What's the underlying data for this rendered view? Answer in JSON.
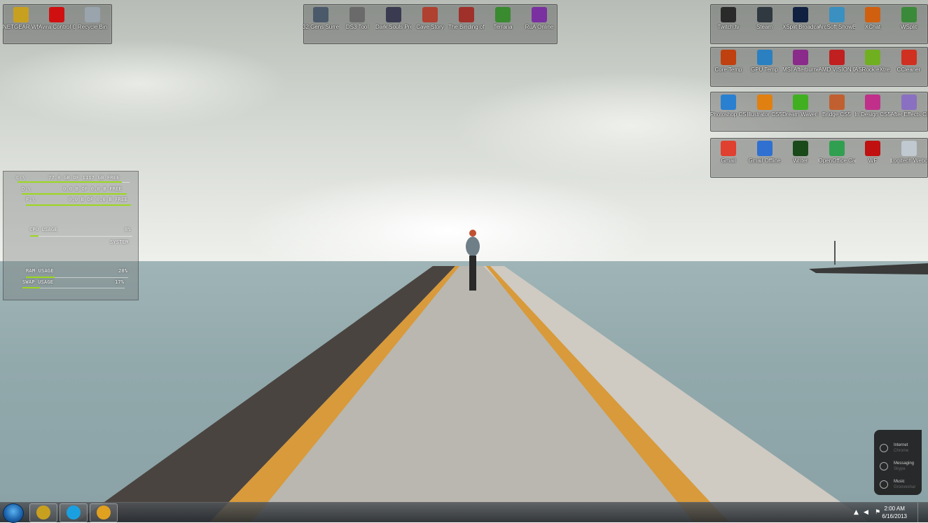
{
  "desktop_groups": {
    "top_left": [
      {
        "label": "NETGEAR WNA31...",
        "icon": "netgear-icon",
        "color": "#c8a020"
      },
      {
        "label": "Avira Control Center",
        "icon": "avira-icon",
        "color": "#d01010"
      },
      {
        "label": "Recycle Bin",
        "icon": "recycle-bin-icon",
        "color": "#9aa4ad"
      }
    ],
    "top_center": [
      {
        "label": "32 Gens Surreal",
        "icon": "gamepad-icon",
        "color": "#4b5a6a"
      },
      {
        "label": "DS3 Tool",
        "icon": "controller-icon",
        "color": "#6a6a6a"
      },
      {
        "label": "Dark Souls Prepare t...",
        "icon": "dark-souls-icon",
        "color": "#3a3a50"
      },
      {
        "label": "Cave Story",
        "icon": "cave-story-icon",
        "color": "#b04030"
      },
      {
        "label": "The Binding of Isaac",
        "icon": "isaac-icon",
        "color": "#a0302a"
      },
      {
        "label": "Terraria",
        "icon": "terraria-icon",
        "color": "#3a8a30"
      },
      {
        "label": "RuA Online",
        "icon": "rua-online-icon",
        "color": "#7a30a0"
      }
    ],
    "right_row1": [
      {
        "label": "Twitch.tv",
        "icon": "twitch-icon",
        "color": "#2a2a2a"
      },
      {
        "label": "Steam",
        "icon": "steam-icon",
        "color": "#303840"
      },
      {
        "label": "XSplit Broadcaster",
        "icon": "xsplit-icon",
        "color": "#102040"
      },
      {
        "label": "ArcSoft ShowBiz",
        "icon": "arcsoft-icon",
        "color": "#3a90c0"
      },
      {
        "label": "XChat",
        "icon": "xchat-icon",
        "color": "#d06010"
      },
      {
        "label": "WSplit",
        "icon": "wsplit-icon",
        "color": "#3a8a3a"
      }
    ],
    "right_row2": [
      {
        "label": "Core Temp",
        "icon": "thermometer-icon",
        "color": "#c04010"
      },
      {
        "label": "GPU Temp",
        "icon": "gpu-temp-icon",
        "color": "#2a80c0"
      },
      {
        "label": "MSI Afterburner",
        "icon": "msi-afterburner-icon",
        "color": "#8a2a8a"
      },
      {
        "label": "AMD VISION Engine CC",
        "icon": "amd-icon",
        "color": "#c02020"
      },
      {
        "label": "ASRock eXtre...",
        "icon": "asrock-icon",
        "color": "#70b020"
      },
      {
        "label": "CCleaner",
        "icon": "ccleaner-icon",
        "color": "#d03020"
      }
    ],
    "right_row3": [
      {
        "label": "Photoshop CS5",
        "icon": "photoshop-folder-icon",
        "color": "#2a80d0"
      },
      {
        "label": "Illustrator CS5",
        "icon": "illustrator-folder-icon",
        "color": "#e08010"
      },
      {
        "label": "Dream Waver CS5",
        "icon": "dreamweaver-folder-icon",
        "color": "#40b020"
      },
      {
        "label": "Bridge CS5",
        "icon": "bridge-folder-icon",
        "color": "#c06030"
      },
      {
        "label": "In Design CS5",
        "icon": "indesign-folder-icon",
        "color": "#c0308a"
      },
      {
        "label": "After Effects CS5",
        "icon": "after-effects-folder-icon",
        "color": "#8a70c0"
      }
    ],
    "right_row4": [
      {
        "label": "Gmail",
        "icon": "gmail-icon",
        "color": "#e04030"
      },
      {
        "label": "Gmail Offline",
        "icon": "gmail-offline-icon",
        "color": "#3070d0"
      },
      {
        "label": "Writer",
        "icon": "writer-icon",
        "color": "#1a4a1a"
      },
      {
        "label": "OpenOffice Calc",
        "icon": "calc-icon",
        "color": "#30a050"
      },
      {
        "label": "WF",
        "icon": "wf-icon",
        "color": "#c01010"
      },
      {
        "label": "Logitech Webca...",
        "icon": "webcam-icon",
        "color": "#c0c8d0"
      }
    ]
  },
  "drive_gadget": {
    "drives": [
      {
        "label": "C:\\",
        "value": "77.0 GB OF 1117 GB FREE",
        "fill": 0.93
      },
      {
        "label": "D:\\",
        "value": "0.0 B OF 0.0 B FREE",
        "fill": 1.0
      },
      {
        "label": "F:\\",
        "value": "0.0 B OF 0.0 B FREE",
        "fill": 1.0
      }
    ],
    "cpu": {
      "label": "CPU USAGE",
      "value": "8%",
      "fill": 0.08,
      "sub": "SYSTEM"
    },
    "ram": {
      "label": "RAM USAGE",
      "value": "28%",
      "fill": 0.28
    },
    "swap": {
      "label": "SWAP USAGE",
      "value": "17%",
      "fill": 0.17
    }
  },
  "media_gadget": [
    {
      "title": "Internet",
      "sub": "Chrome"
    },
    {
      "title": "Messaging",
      "sub": "Skype"
    },
    {
      "title": "Music",
      "sub": "Grooveshar"
    }
  ],
  "taskbar": {
    "pinned": [
      {
        "icon": "netgear-icon",
        "color": "#c8a020"
      },
      {
        "icon": "skype-icon",
        "color": "#1aa0e0"
      },
      {
        "icon": "chrome-icon",
        "color": "#e0a020"
      }
    ],
    "tray": {
      "time": "2:00 AM",
      "date": "6/16/2013"
    }
  }
}
